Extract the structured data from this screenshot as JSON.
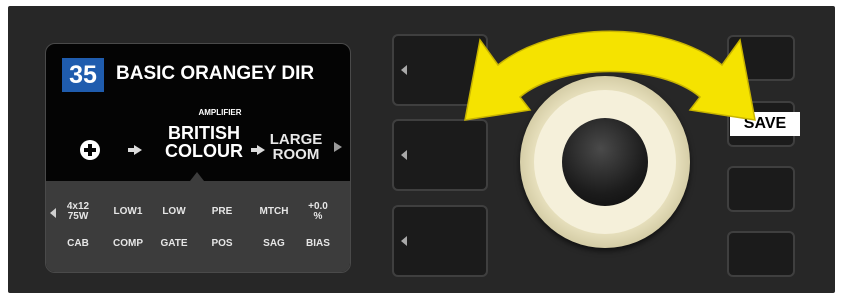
{
  "preset": {
    "number": "35",
    "name": "BASIC ORANGEY DIR"
  },
  "signal_chain": {
    "selected_label": "AMPLIFIER",
    "amplifier": {
      "line1": "BRITISH",
      "line2": "COLOUR"
    },
    "cabinet": {
      "line1": "LARGE",
      "line2": "ROOM"
    }
  },
  "params": [
    {
      "value": "4x12 75W",
      "value_line1": "4x12",
      "value_line2": "75W",
      "label": "CAB"
    },
    {
      "value": "LOW1",
      "label": "COMP"
    },
    {
      "value": "LOW",
      "label": "GATE"
    },
    {
      "value": "PRE",
      "label": "POS"
    },
    {
      "value": "MTCH",
      "label": "SAG"
    },
    {
      "value": "+0.0 %",
      "value_line1": "+0.0",
      "value_line2": "%",
      "label": "BIAS"
    }
  ],
  "buttons": {
    "save_label": "SAVE"
  },
  "icons": [
    "add-block-icon",
    "signal-flow-arrow-icon",
    "scroll-left-icon",
    "scroll-right-icon",
    "rotate-knob-arrow-icon"
  ],
  "colors": {
    "preset_badge": "#1f5cae",
    "arrow_yellow": "#f5e300",
    "knob_cream": "#ece5c3"
  }
}
